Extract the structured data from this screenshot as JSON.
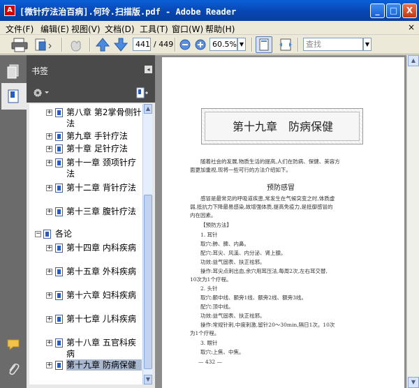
{
  "window": {
    "title": "[微针疗法治百病].何玲.扫描版.pdf - Adobe Reader",
    "minimize": "_",
    "maximize": "□",
    "close": "X"
  },
  "menu": {
    "items": [
      "文件(F)",
      "编辑(E)",
      "视图(V)",
      "文档(D)",
      "工具(T)",
      "窗口(W)",
      "帮助(H)"
    ],
    "close_glyph": "×"
  },
  "toolbar": {
    "page_current": "441",
    "page_total": "/ 449",
    "zoom": "60.5%",
    "search_placeholder": "查找"
  },
  "bookmarks_panel": {
    "title": "书签",
    "items": [
      {
        "label": "第八章 第2掌骨侧针法",
        "expanded": false,
        "selected": false
      },
      {
        "label": "第九章 手针疗法",
        "expanded": false,
        "selected": false
      },
      {
        "label": "第十章 足针疗法",
        "expanded": false,
        "selected": false
      },
      {
        "label": "第十一章 颈项针疗法",
        "expanded": false,
        "selected": false
      },
      {
        "label": "第十二章 背针疗法",
        "expanded": false,
        "selected": false
      },
      {
        "label": "第十三章 腹针疗法",
        "expanded": false,
        "selected": false
      },
      {
        "label": "各论",
        "expanded": true,
        "selected": false
      },
      {
        "label": "第十四章 内科疾病",
        "expanded": false,
        "selected": false
      },
      {
        "label": "第十五章 外科疾病",
        "expanded": false,
        "selected": false
      },
      {
        "label": "第十六章 妇科疾病",
        "expanded": false,
        "selected": false
      },
      {
        "label": "第十七章 儿科疾病",
        "expanded": false,
        "selected": false
      },
      {
        "label": "第十八章 五官科疾病",
        "expanded": false,
        "selected": false
      },
      {
        "label": "第十九章 防病保健",
        "expanded": false,
        "selected": true
      }
    ]
  },
  "document": {
    "chapter_title": "第十九章　防病保健",
    "intro_lines": [
      "随着社会的发展,物质生活的提高,人们在防病、保健、美容方",
      "面更加重视,现将一些可行的方法介绍如下。"
    ],
    "section_title": "预防感冒",
    "body_lines": [
      "感冒是最常见的呼吸道疾患,常发生在气候突变之时,体质虚",
      "弱,抵抗力下降最易感染,故增强体质,提高免疫力,是抵御感冒的",
      "内在因素。",
      "【预防方法】",
      "1. 耳针",
      "取穴:肺、脾、内鼻。",
      "配穴:耳尖、风溪、内分泌、肾上腺。",
      "功效:益气固表、扶正祛邪。",
      "操作:耳尖点刺出血,余穴用耳压法,每周2次,左右耳交替,",
      "10次为1个疗程。",
      "2. 头针",
      "取穴:额中线、额旁1线、额旁2线、额旁3线。",
      "配穴:顶中线。",
      "功效:益气固表、扶正祛邪。",
      "操作:常规针刺,中度刺激,留针20～30min,隔日1次。10次",
      "为1个疗程。",
      "3. 眼针",
      "取穴:上焦、中焦。"
    ],
    "page_number": "— 432 —"
  }
}
